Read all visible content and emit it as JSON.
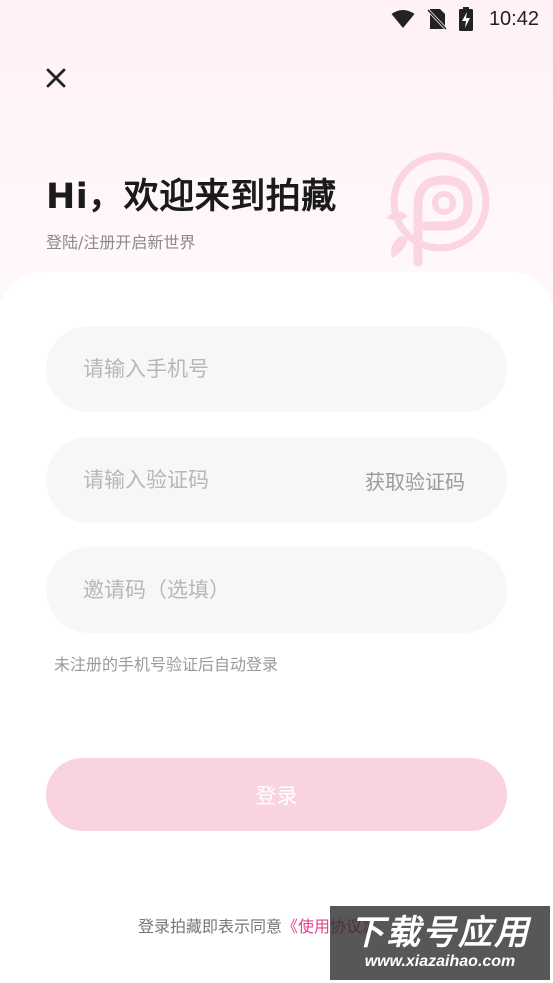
{
  "status_bar": {
    "time": "10:42",
    "icons": [
      "wifi-icon",
      "no-sim-icon",
      "battery-charging-icon"
    ]
  },
  "header": {
    "close_icon": "close-icon",
    "title": "Hi，欢迎来到拍藏",
    "subtitle": "登陆/注册开启新世界",
    "logo_icon": "paicang-logo-icon"
  },
  "form": {
    "phone_placeholder": "请输入手机号",
    "phone_value": "",
    "code_placeholder": "请输入验证码",
    "code_value": "",
    "get_code_label": "获取验证码",
    "invite_placeholder": "邀请码（选填）",
    "invite_value": "",
    "hint": "未注册的手机号验证后自动登录",
    "login_label": "登录"
  },
  "agreement": {
    "prefix": "登录拍藏即表示同意",
    "link": "《使用协议》"
  },
  "watermark": {
    "main": "下载号应用",
    "sub": "www.xiazaihao.com"
  },
  "colors": {
    "accent": "#e0428b",
    "login_button": "#fad3e2",
    "header_bg": "#fff1f4",
    "field_bg": "#f7f7f7"
  }
}
